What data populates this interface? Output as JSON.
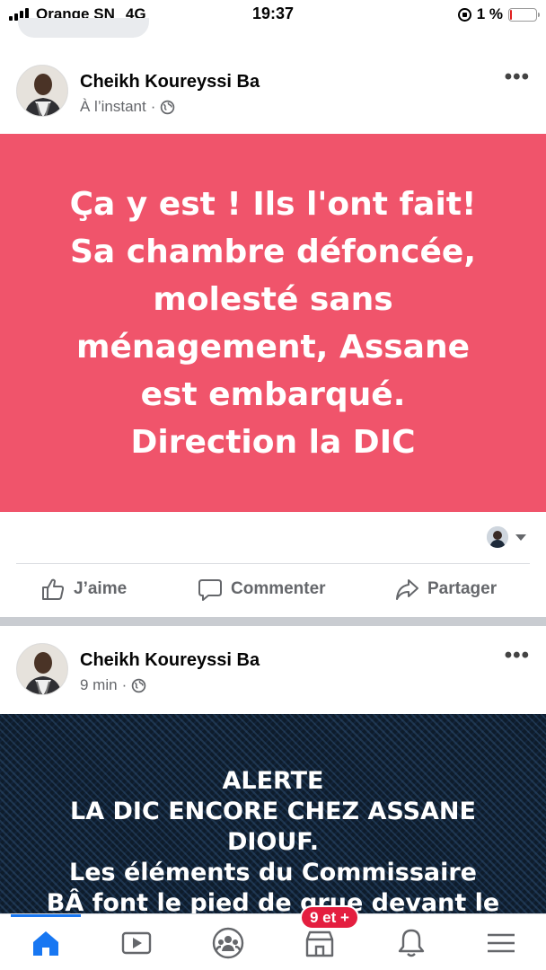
{
  "status_bar": {
    "carrier": "Orange SN",
    "network": "4G",
    "time": "19:37",
    "battery": "1 %",
    "battery_level": 0.01
  },
  "posts": [
    {
      "author": "Cheikh Koureyssi Ba",
      "time": "À l’instant",
      "separator": "·",
      "audience_icon": "globe-icon",
      "content": "Ça y est ! Ils l'ont fait!\nSa chambre défoncée,\nmolesté sans\nménagement, Assane\nest embarqué.\nDirection la DIC",
      "background_color": "#f0546b",
      "actions": {
        "like": "J’aime",
        "comment": "Commenter",
        "share": "Partager"
      }
    },
    {
      "author": "Cheikh Koureyssi Ba",
      "time": "9 min",
      "separator": "·",
      "audience_icon": "globe-icon",
      "content": "ALERTE\nLA DIC ENCORE CHEZ ASSANE\nDIOUF.\nLes éléments du Commissaire\nBÂ font le pied de grue devant le"
    }
  ],
  "tab_bar": {
    "items": [
      "home-icon",
      "video-icon",
      "groups-icon",
      "marketplace-icon",
      "notifications-icon",
      "menu-icon"
    ],
    "badge": "9 et +",
    "active_color": "#1877f2"
  }
}
